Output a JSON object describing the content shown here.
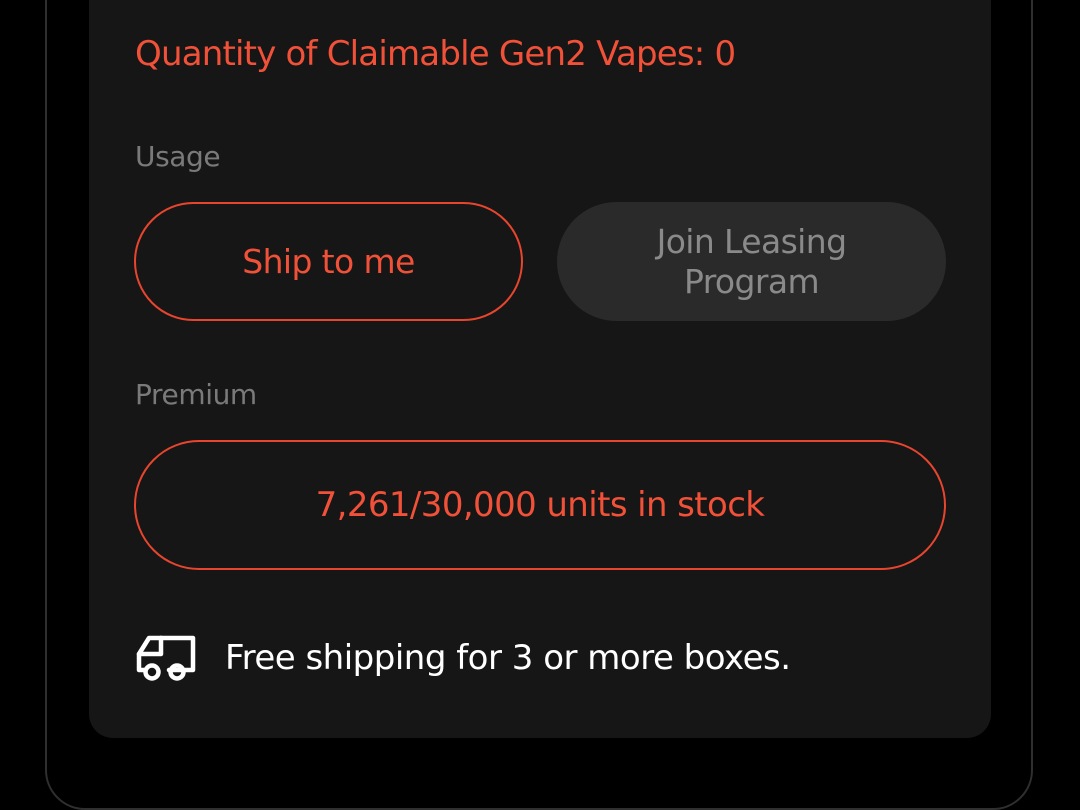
{
  "claim": {
    "text": "Quantity of Claimable Gen2 Vapes: 0"
  },
  "usage": {
    "label": "Usage",
    "options": [
      {
        "label": "Ship to me",
        "state": "selected"
      },
      {
        "label": "Join Leasing Program",
        "state": "unselected"
      }
    ]
  },
  "premium": {
    "label": "Premium",
    "stock_text": "7,261/30,000 units in stock"
  },
  "shipping": {
    "icon": "truck-icon",
    "text": "Free shipping for 3 or more boxes."
  },
  "colors": {
    "accent": "#f05138",
    "card_background": "#161616",
    "page_background": "#000000",
    "inactive_button": "#2a2a2a",
    "muted_text": "#7a7a7a"
  }
}
